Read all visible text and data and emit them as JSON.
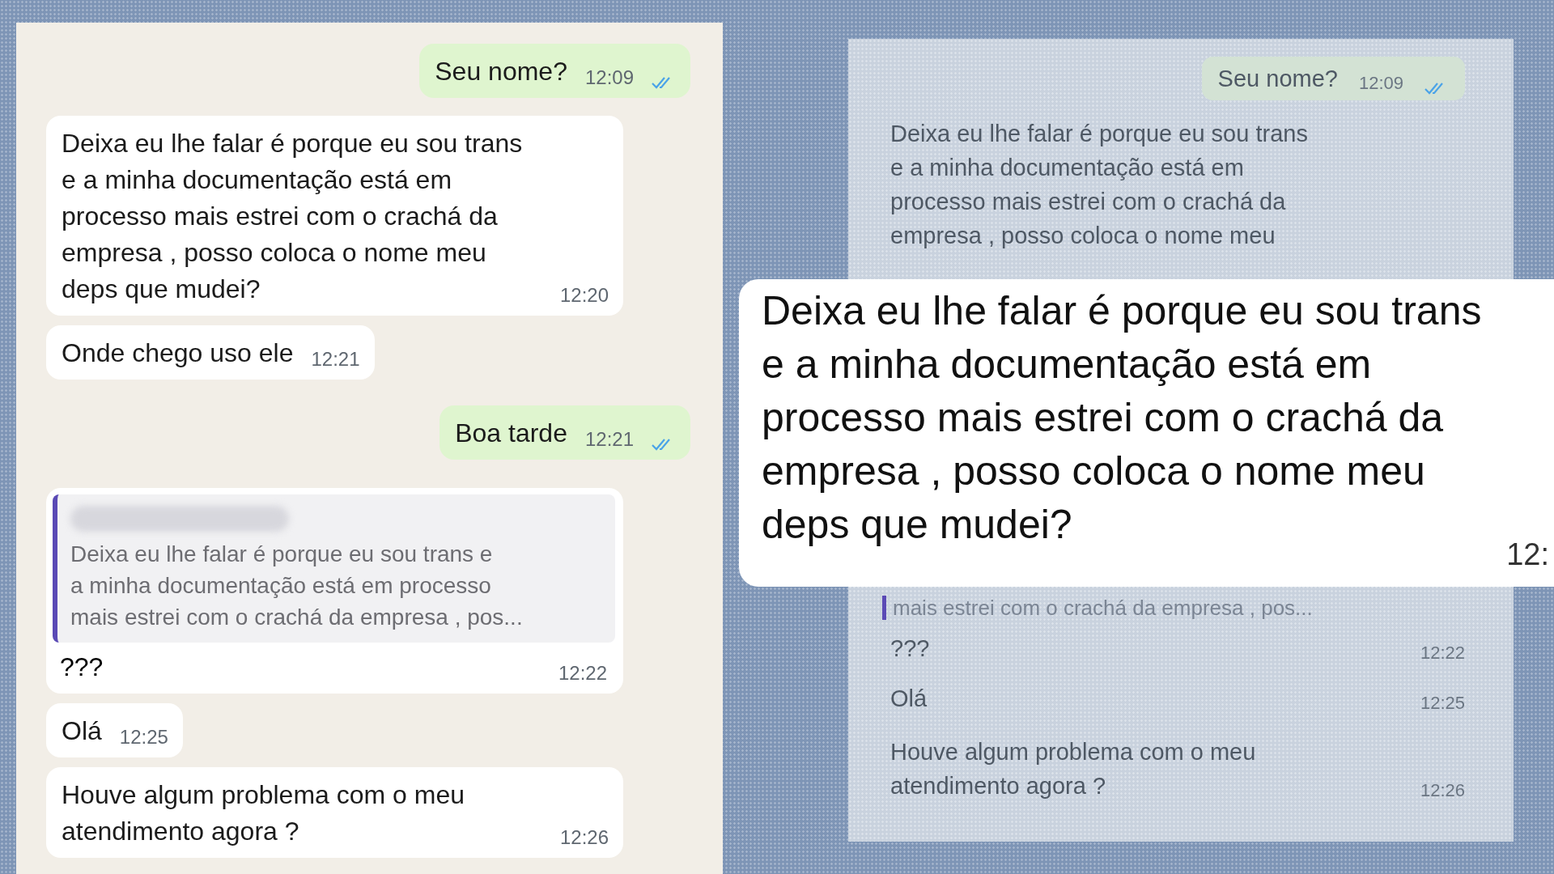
{
  "left_chat": {
    "messages": [
      {
        "kind": "outgoing",
        "text": "Seu nome?",
        "time": "12:09",
        "read": true
      },
      {
        "kind": "incoming",
        "text": "Deixa eu lhe falar é porque eu sou trans\ne a minha documentação está em\nprocesso mais estrei com o crachá da\nempresa , posso coloca o nome meu\ndeps que mudei?",
        "time": "12:20"
      },
      {
        "kind": "incoming",
        "text": "Onde chego uso ele",
        "time": "12:21"
      },
      {
        "kind": "outgoing",
        "text": "Boa tarde",
        "time": "12:21",
        "read": true
      },
      {
        "kind": "reply",
        "quote": "Deixa eu lhe falar é porque eu sou trans e\na minha documentação está em processo\nmais estrei com o crachá da empresa , pos...",
        "text": "???",
        "time": "12:22"
      },
      {
        "kind": "incoming",
        "text": "Olá",
        "time": "12:25"
      },
      {
        "kind": "incoming",
        "text": "Houve algum problema com o meu\natendimento agora ?",
        "time": "12:26"
      }
    ]
  },
  "right_chat": {
    "messages": [
      {
        "kind": "outgoing",
        "text": "Seu nome?",
        "time": "12:09",
        "read": true
      },
      {
        "kind": "incoming",
        "text": "Deixa eu lhe falar é porque eu sou trans\ne a minha documentação está em\nprocesso mais estrei com o crachá da\nempresa , posso coloca o nome meu"
      },
      {
        "kind": "quote",
        "text": "mais estrei com o crachá da empresa , pos..."
      },
      {
        "kind": "incoming",
        "text": "???",
        "time": "12:22"
      },
      {
        "kind": "incoming",
        "text": "Olá",
        "time": "12:25"
      },
      {
        "kind": "incoming",
        "text": "Houve algum problema com o meu\natendimento agora ?",
        "time": "12:26"
      }
    ]
  },
  "zoom_callout": {
    "text": "Deixa eu lhe falar é porque eu sou trans\ne a minha documentação está em\nprocesso mais estrei com o crachá da\nempresa , posso coloca o nome meu\ndeps que mudei?",
    "time": "12:"
  }
}
